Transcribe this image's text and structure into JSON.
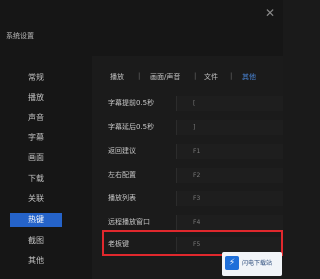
{
  "window": {
    "title": "系统设置",
    "close_glyph": "✕"
  },
  "sidebar": {
    "items": [
      {
        "label": "常规",
        "active": false
      },
      {
        "label": "播放",
        "active": false
      },
      {
        "label": "声音",
        "active": false
      },
      {
        "label": "字幕",
        "active": false
      },
      {
        "label": "画面",
        "active": false
      },
      {
        "label": "下载",
        "active": false
      },
      {
        "label": "关联",
        "active": false
      },
      {
        "label": "热键",
        "active": true
      },
      {
        "label": "截图",
        "active": false
      },
      {
        "label": "其他",
        "active": false
      }
    ]
  },
  "tabs": [
    {
      "label": "播放",
      "active": false
    },
    {
      "label": "画面/声音",
      "active": false
    },
    {
      "label": "文件",
      "active": false
    },
    {
      "label": "其他",
      "active": true
    }
  ],
  "hotkeys": [
    {
      "label": "字幕提前0.5秒",
      "value": "["
    },
    {
      "label": "字幕延后0.5秒",
      "value": "]"
    },
    {
      "label": "返回建议",
      "value": "F1"
    },
    {
      "label": "左右配置",
      "value": "F2"
    },
    {
      "label": "播放列表",
      "value": "F3"
    },
    {
      "label": "远程播放窗口",
      "value": "F4"
    },
    {
      "label": "老板键",
      "value": "F5"
    }
  ],
  "watermark": {
    "text": "闪电下载站",
    "icon": "lightning-icon",
    "glyph": "⚡"
  },
  "colors": {
    "accent": "#2563c9",
    "highlight_border": "#e0282d",
    "active_tab": "#4a86d8"
  }
}
